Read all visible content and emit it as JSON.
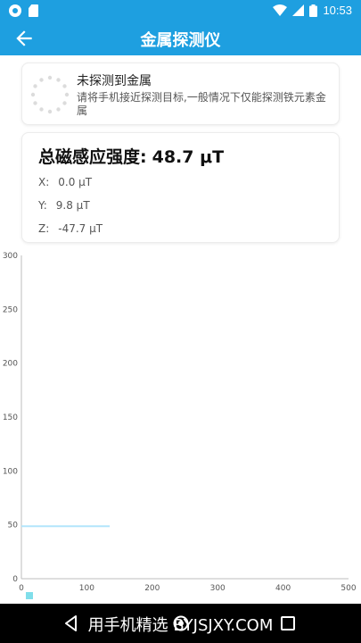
{
  "status_bar": {
    "time": "10:53",
    "icons": [
      "notification-dot-icon",
      "sd-card-icon",
      "wifi-icon",
      "signal-icon",
      "battery-icon"
    ]
  },
  "app_bar": {
    "title": "金属探测仪",
    "back_icon": "arrow-left-icon"
  },
  "detection": {
    "title": "未探测到金属",
    "description": "请将手机接近探测目标,一般情况下仅能探测铁元素金属"
  },
  "field": {
    "total_label": "总磁感应强度:",
    "total_value": "48.7 μT",
    "x_label": "X:",
    "x_value": "0.0 μT",
    "y_label": "Y:",
    "y_value": "9.8 μT",
    "z_label": "Z:",
    "z_value": "-47.7 μT"
  },
  "chart_data": {
    "type": "line",
    "xlim": [
      0,
      500
    ],
    "ylim": [
      0,
      300
    ],
    "x_ticks": [
      0,
      100,
      200,
      300,
      400,
      500
    ],
    "y_ticks": [
      0,
      50,
      100,
      150,
      200,
      250,
      300
    ],
    "series": [
      {
        "x": [
          0,
          135
        ],
        "y": [
          48.7,
          48.7
        ],
        "color": "#b3e5fc"
      }
    ],
    "legend": "bottom-left",
    "legend_color": "#80deea",
    "grid": false
  },
  "bottom_bar": {
    "watermark": "用手机精选 BYJSJXY.COM"
  }
}
